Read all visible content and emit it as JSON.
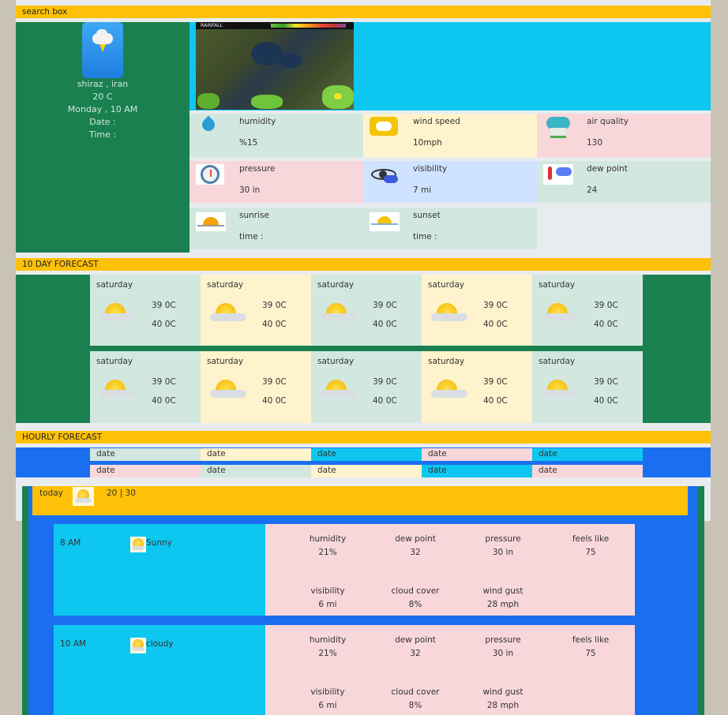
{
  "search": {
    "label": "search box"
  },
  "current": {
    "city": "shiraz , iran",
    "temp": "20 C",
    "day_time": "Monday , 10 AM",
    "date_label": "Date :",
    "time_label": "Time :"
  },
  "map": {
    "title": "RAINFALL"
  },
  "details": [
    {
      "label": "humidity",
      "value": "%15",
      "icon": "water-drop-icon",
      "bg": "#d2e8df"
    },
    {
      "label": "wind speed",
      "value": "10mph",
      "icon": "wind-icon",
      "bg": "#fff3cd"
    },
    {
      "label": "air quality",
      "value": "130",
      "icon": "air-quality-icon",
      "bg": "#f8d7da"
    },
    {
      "label": "pressure",
      "value": "30 in",
      "icon": "pressure-gauge-icon",
      "bg": "#f8d7da"
    },
    {
      "label": "visibility",
      "value": "7 mi",
      "icon": "eye-icon",
      "bg": "#cfe2ff"
    },
    {
      "label": "dew point",
      "value": "24",
      "icon": "thermometer-icon",
      "bg": "#d2e8df"
    },
    {
      "label": "sunrise",
      "value": "time :",
      "icon": "sunrise-icon",
      "bg": "#d2e8df"
    },
    {
      "label": "sunset",
      "value": "time :",
      "icon": "sunset-icon",
      "bg": "#d2e8df"
    }
  ],
  "ten_day": {
    "title": "10 DAY FORECAST",
    "days": [
      {
        "day": "saturday",
        "high": "39 0C",
        "low": "40 0C"
      },
      {
        "day": "saturday",
        "high": "39 0C",
        "low": "40 0C"
      },
      {
        "day": "saturday",
        "high": "39 0C",
        "low": "40 0C"
      },
      {
        "day": "saturday",
        "high": "39 0C",
        "low": "40 0C"
      },
      {
        "day": "saturday",
        "high": "39 0C",
        "low": "40 0C"
      },
      {
        "day": "saturday",
        "high": "39 0C",
        "low": "40 0C"
      },
      {
        "day": "saturday",
        "high": "39 0C",
        "low": "40 0C"
      },
      {
        "day": "saturday",
        "high": "39 0C",
        "low": "40 0C"
      },
      {
        "day": "saturday",
        "high": "39 0C",
        "low": "40 0C"
      },
      {
        "day": "saturday",
        "high": "39 0C",
        "low": "40 0C"
      }
    ]
  },
  "hourly": {
    "title": "HOURLY FORECAST",
    "dates": [
      "date",
      "date",
      "date",
      "date",
      "date",
      "date",
      "date",
      "date",
      "date",
      "date"
    ]
  },
  "today": {
    "label": "today",
    "range": "20 | 30"
  },
  "hours": [
    {
      "time": "8 AM",
      "condition": "Sunny",
      "stats": [
        {
          "label": "humidity",
          "value": "21%"
        },
        {
          "label": "dew point",
          "value": "32"
        },
        {
          "label": "pressure",
          "value": "30 in"
        },
        {
          "label": "feels like",
          "value": "75"
        },
        {
          "label": "visibility",
          "value": "6 mi"
        },
        {
          "label": "cloud cover",
          "value": "8%"
        },
        {
          "label": "wind gust",
          "value": "28 mph"
        }
      ]
    },
    {
      "time": "10 AM",
      "condition": "cloudy",
      "stats": [
        {
          "label": "humidity",
          "value": "21%"
        },
        {
          "label": "dew point",
          "value": "32"
        },
        {
          "label": "pressure",
          "value": "30 in"
        },
        {
          "label": "feels like",
          "value": "75"
        },
        {
          "label": "visibility",
          "value": "6 mi"
        },
        {
          "label": "cloud cover",
          "value": "8%"
        },
        {
          "label": "wind gust",
          "value": "28 mph"
        }
      ]
    }
  ]
}
